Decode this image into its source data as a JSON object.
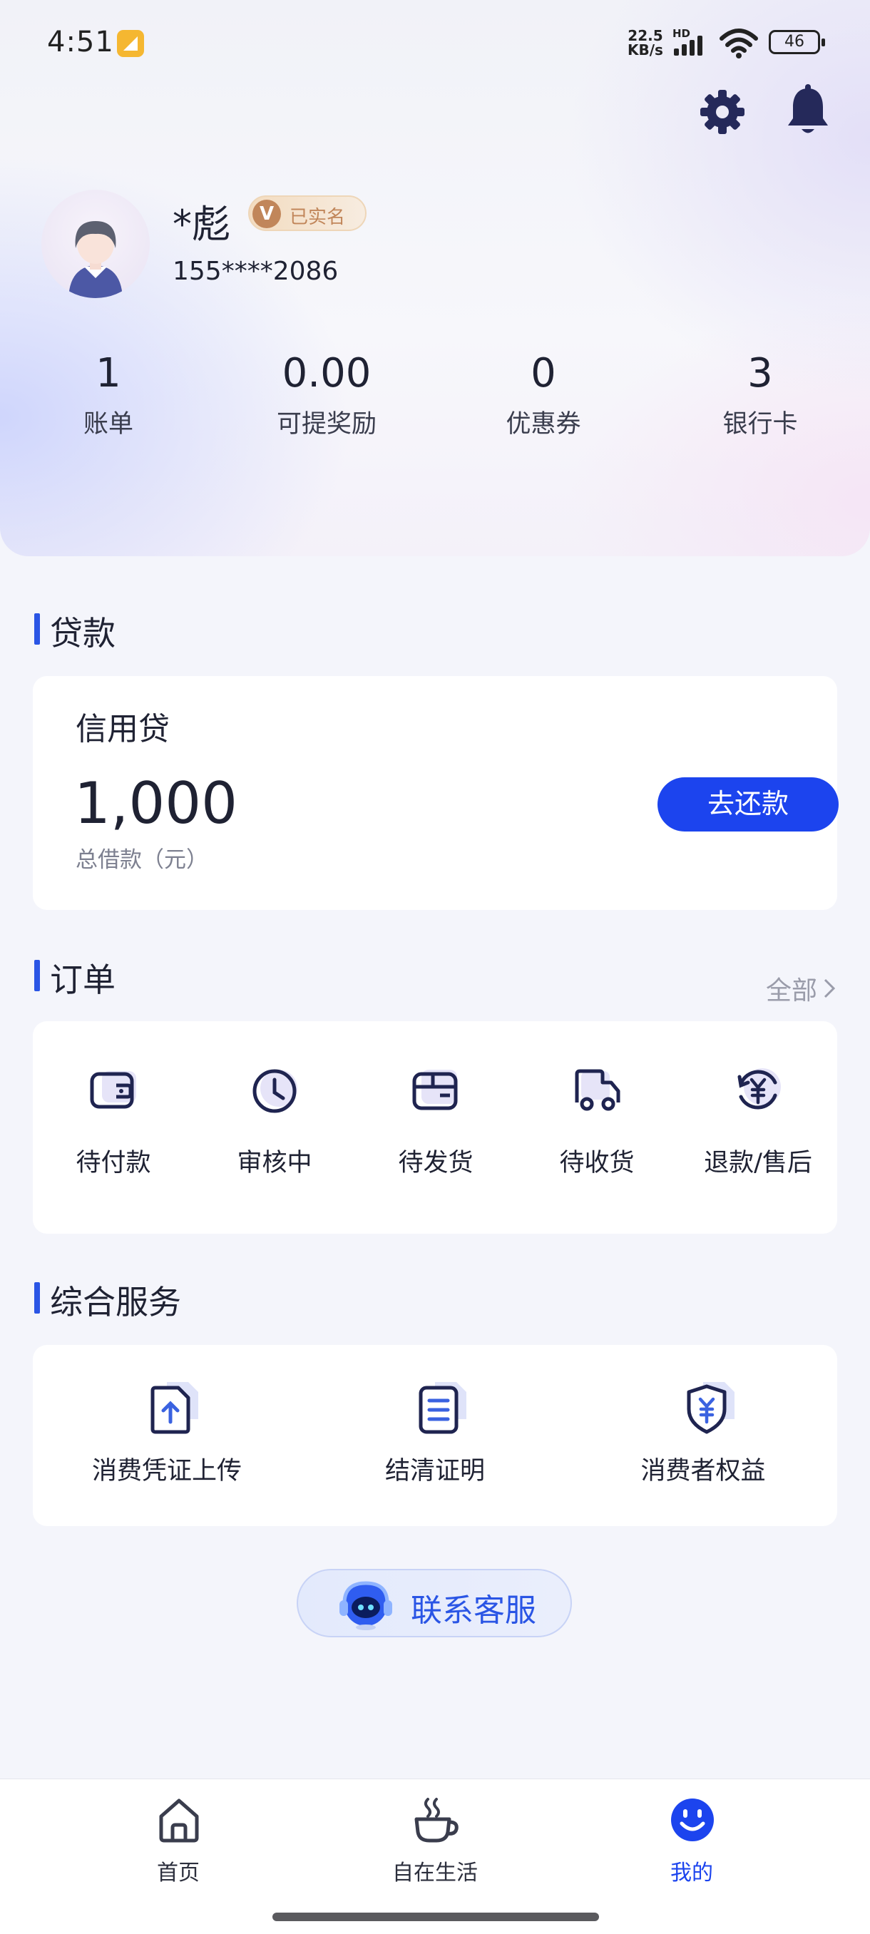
{
  "status_bar": {
    "time": "4:51",
    "net_speed_value": "22.5",
    "net_speed_unit": "KB/s",
    "network_type": "HD",
    "battery": "46"
  },
  "profile": {
    "name": "*彪",
    "verified_badge": "V",
    "verified_label": "已实名",
    "phone": "155****2086"
  },
  "stats": [
    {
      "value": "1",
      "label": "账单"
    },
    {
      "value": "0.00",
      "label": "可提奖励"
    },
    {
      "value": "0",
      "label": "优惠券"
    },
    {
      "value": "3",
      "label": "银行卡"
    }
  ],
  "loan": {
    "section_title": "贷款",
    "product_name": "信用贷",
    "amount": "1,000",
    "amount_caption": "总借款（元）",
    "repay_button": "去还款"
  },
  "orders": {
    "section_title": "订单",
    "all_link": "全部",
    "items": [
      {
        "label": "待付款",
        "icon": "wallet-icon"
      },
      {
        "label": "审核中",
        "icon": "clock-icon"
      },
      {
        "label": "待发货",
        "icon": "package-icon"
      },
      {
        "label": "待收货",
        "icon": "truck-icon"
      },
      {
        "label": "退款/售后",
        "icon": "refund-icon"
      }
    ]
  },
  "services": {
    "section_title": "综合服务",
    "items": [
      {
        "label": "消费凭证上传",
        "icon": "upload-document-icon"
      },
      {
        "label": "结清证明",
        "icon": "certificate-icon"
      },
      {
        "label": "消费者权益",
        "icon": "shield-yuan-icon"
      }
    ]
  },
  "contact": {
    "label": "联系客服",
    "icon": "customer-service-icon"
  },
  "tabbar": {
    "items": [
      {
        "label": "首页",
        "icon": "home-icon",
        "active": false
      },
      {
        "label": "自在生活",
        "icon": "coffee-icon",
        "active": false
      },
      {
        "label": "我的",
        "icon": "smiley-icon",
        "active": true
      }
    ]
  },
  "colors": {
    "accent": "#1c44ee",
    "section_bar": "#2a55e5",
    "background": "#f4f5fb",
    "icon_dark": "#1f2450",
    "icon_tint": "#e6e4f8",
    "verified_bg": "#f3dcc0",
    "verified_text": "#c1865a"
  }
}
